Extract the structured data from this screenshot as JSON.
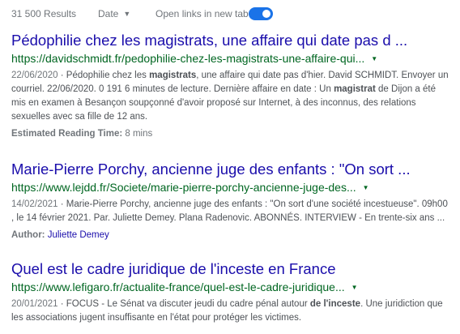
{
  "toolbar": {
    "results_count": "31 500 Results",
    "date_filter_label": "Date",
    "open_links_label": "Open links in new tab",
    "open_links_enabled": true
  },
  "results": [
    {
      "title": "Pédophilie chez les magistrats, une affaire qui date pas d ...",
      "url": "https://davidschmidt.fr/pedophilie-chez-les-magistrats-une-affaire-qui...",
      "date": "22/06/2020",
      "snippet_parts": {
        "a": " · Pédophilie chez les ",
        "b1": "magistrats",
        "c": ", une affaire qui date pas d'hier. David SCHMIDT. Envoyer un courriel. 22/06/2020. 0 191 6 minutes de lecture. Dernière affaire en date : Un ",
        "b2": "magistrat",
        "d": " de Dijon a été mis en examen à Besançon soupçonné d'avoir proposé sur Internet, à des inconnus, des relations sexuelles avec sa fille de 12 ans."
      },
      "meta_label": "Estimated Reading Time:",
      "meta_value": "8 mins"
    },
    {
      "title": "Marie-Pierre Porchy, ancienne juge des enfants : \"On sort ...",
      "url": "https://www.lejdd.fr/Societe/marie-pierre-porchy-ancienne-juge-des...",
      "date": "14/02/2021",
      "snippet_parts": {
        "a": " · Marie-Pierre Porchy, ancienne juge des enfants : \"On sort d'une société incestueuse\". 09h00 , le 14 février 2021. Par. Juliette Demey. Plana Radenovic. ABONNÉS. INTERVIEW - En trente-six ans ..."
      },
      "meta_label": "Author:",
      "meta_value": "Juliette Demey"
    },
    {
      "title": "Quel est le cadre juridique de l'inceste en France",
      "url": "https://www.lefigaro.fr/actualite-france/quel-est-le-cadre-juridique...",
      "date": "20/01/2021",
      "snippet_parts": {
        "a": " · FOCUS - Le Sénat va discuter jeudi du cadre pénal autour ",
        "b1": "de l'inceste",
        "c": ". Une juridiction que les associations jugent insuffisante en l'état pour protéger les victimes."
      }
    }
  ]
}
